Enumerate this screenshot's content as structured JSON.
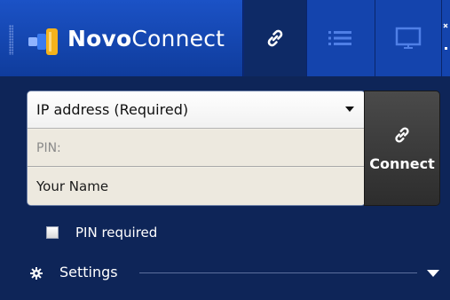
{
  "brand": {
    "name_bold": "Novo",
    "name_light": "Connect"
  },
  "tabs": [
    {
      "icon": "link-icon",
      "active": true
    },
    {
      "icon": "list-icon",
      "active": false
    },
    {
      "icon": "presentation-icon",
      "active": false
    }
  ],
  "form": {
    "ip_placeholder": "IP address (Required)",
    "pin_placeholder": "PIN:",
    "name_value": "Your Name"
  },
  "connect": {
    "label": "Connect"
  },
  "pin_required": {
    "label": "PIN required",
    "checked": false
  },
  "settings": {
    "label": "Settings"
  },
  "colors": {
    "brand_blue": "#1b52c6",
    "panel": "#0e2558",
    "connect_btn": "#3a3a3a"
  }
}
